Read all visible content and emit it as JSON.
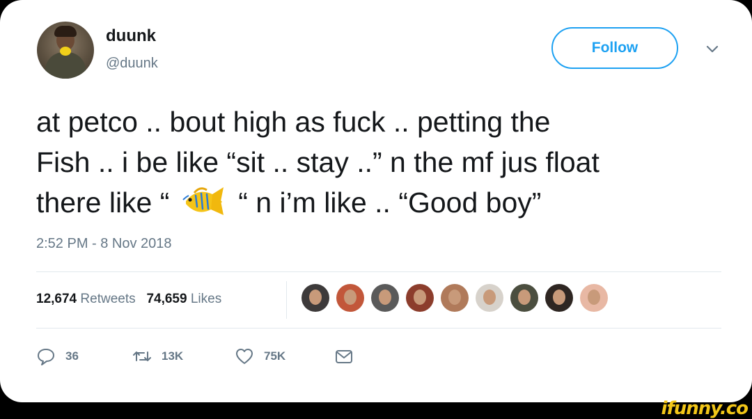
{
  "author": {
    "name": "duunk",
    "handle": "@duunk"
  },
  "follow_label": "Follow",
  "tweet": {
    "line1": "at petco .. bout high as fuck .. petting the",
    "line2": "Fish .. i be like “sit .. stay ..” n the mf jus float",
    "line3_before": "there like “",
    "line3_after": "“ n i’m like .. “Good boy”",
    "emoji": "tropical-fish"
  },
  "timestamp": "2:52 PM - 8 Nov 2018",
  "stats": {
    "retweets_count": "12,674",
    "retweets_label": "Retweets",
    "likes_count": "74,659",
    "likes_label": "Likes"
  },
  "likers": [
    {
      "color": "#3d3a3a"
    },
    {
      "color": "#c2573a"
    },
    {
      "color": "#5a5a5a"
    },
    {
      "color": "#8c3d2c"
    },
    {
      "color": "#b07a5a"
    },
    {
      "color": "#d7d2cb"
    },
    {
      "color": "#4b4e3f"
    },
    {
      "color": "#2e2622"
    },
    {
      "color": "#e8b8a4"
    }
  ],
  "actions": {
    "replies": "36",
    "retweets": "13K",
    "likes": "75K"
  },
  "colors": {
    "accent": "#1da1f2",
    "muted": "#657786",
    "text": "#14171a"
  },
  "watermark": "ifunny.co"
}
